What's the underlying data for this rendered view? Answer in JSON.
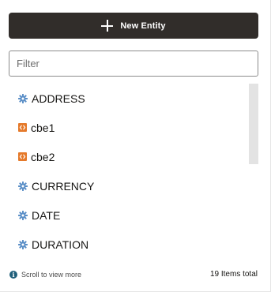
{
  "toolbar": {
    "new_entity_label": "New Entity",
    "new_entity_icon": "plus-icon"
  },
  "filter": {
    "placeholder": "Filter",
    "value": ""
  },
  "entities": [
    {
      "label": "ADDRESS",
      "icon": "gear-icon"
    },
    {
      "label": "cbe1",
      "icon": "composite-bag-icon"
    },
    {
      "label": "cbe2",
      "icon": "composite-bag-icon"
    },
    {
      "label": "CURRENCY",
      "icon": "gear-icon"
    },
    {
      "label": "DATE",
      "icon": "gear-icon"
    },
    {
      "label": "DURATION",
      "icon": "gear-icon"
    }
  ],
  "footer": {
    "scroll_hint": "Scroll to view more",
    "items_total": "19 Items total"
  },
  "colors": {
    "button_bg": "#312d2a",
    "gear_icon": "#5b8fc7",
    "cbe_icon": "#e57a2b",
    "info_icon": "#1f5f7a"
  }
}
